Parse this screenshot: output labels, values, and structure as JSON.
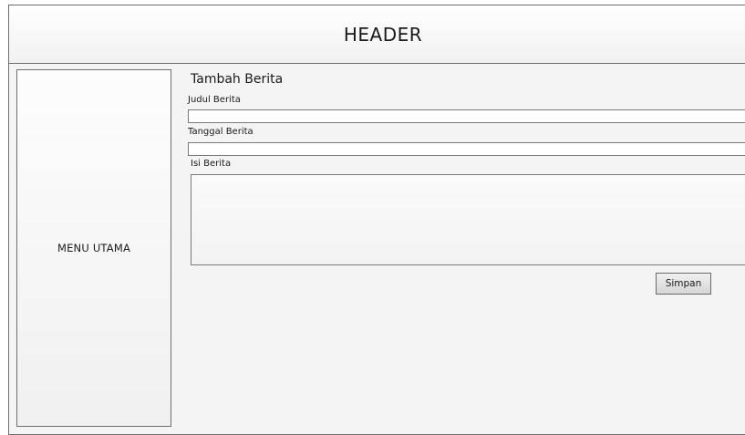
{
  "header": {
    "title": "HEADER"
  },
  "sidebar": {
    "label": "MENU UTAMA"
  },
  "form": {
    "title": "Tambah Berita",
    "fields": {
      "judul": {
        "label": "Judul Berita",
        "value": ""
      },
      "tanggal": {
        "label": "Tanggal Berita",
        "value": ""
      },
      "isi": {
        "label": "Isi Berita",
        "value": ""
      }
    },
    "submit_label": "Simpan"
  }
}
